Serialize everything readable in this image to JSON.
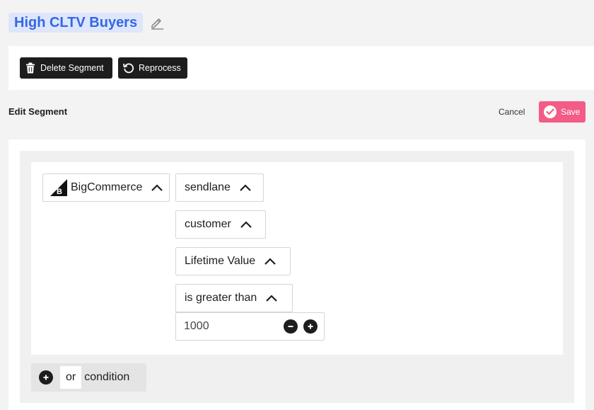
{
  "segment": {
    "title": "High CLTV Buyers",
    "title_color": "#3567e6",
    "title_bg": "#dde6fb",
    "edit_icon": "pencil-icon"
  },
  "actions": {
    "delete_label": "Delete Segment",
    "delete_icon": "trash-icon",
    "reprocess_label": "Reprocess",
    "reprocess_icon": "refresh-icon"
  },
  "editor": {
    "header": "Edit Segment",
    "cancel_label": "Cancel",
    "save_label": "Save",
    "save_color": "#f25c86"
  },
  "condition": {
    "platform": "BigCommerce",
    "platform_icon": "bigcommerce-logo",
    "source": "sendlane",
    "object": "customer",
    "field": "Lifetime Value",
    "operator": "is greater than",
    "value": "1000"
  },
  "add_condition": {
    "or_label": "or",
    "condition_label": "condition"
  }
}
